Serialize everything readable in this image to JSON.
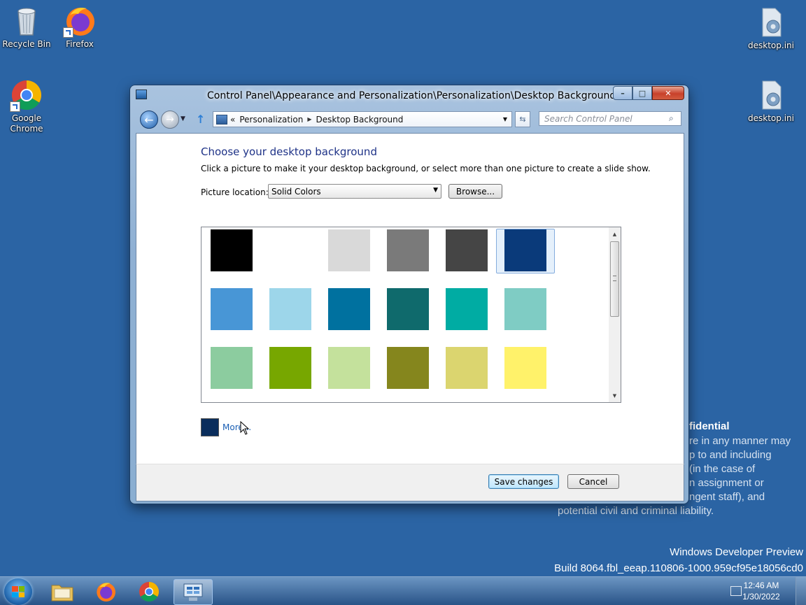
{
  "desktop": {
    "icons": [
      {
        "label": "Recycle Bin",
        "icon": "recycle-bin-icon"
      },
      {
        "label": "Firefox",
        "icon": "firefox-icon"
      },
      {
        "label": "Google Chrome",
        "icon": "chrome-icon"
      },
      {
        "label": "desktop.ini",
        "icon": "settings-file-icon"
      },
      {
        "label": "desktop.ini",
        "icon": "settings-file-icon"
      }
    ],
    "watermark": {
      "confidential_heading": "fidential",
      "lines": [
        "re in any manner may",
        "p to and including",
        "(in the case of",
        "n assignment or",
        "ngent staff), and",
        "potential civil and criminal liability."
      ],
      "product": "Windows Developer Preview",
      "build": "Build 8064.fbl_eeap.110806-1000.959cf95e18056cd0"
    }
  },
  "window": {
    "title": "Control Panel\\Appearance and Personalization\\Personalization\\Desktop Background",
    "buttons": {
      "minimize": "–",
      "maximize": "□",
      "close": "✕"
    },
    "nav": {
      "back": "←",
      "forward": "→",
      "up": "↑",
      "breadcrumb": {
        "prefix": "«",
        "items": [
          "Personalization",
          "Desktop Background"
        ],
        "sep": "▶"
      },
      "search_placeholder": "Search Control Panel"
    },
    "content": {
      "heading": "Choose your desktop background",
      "description": "Click a picture to make it your desktop background, or select more than one picture to create a slide show.",
      "picture_location_label": "Picture location:",
      "picture_location_value": "Solid Colors",
      "browse_label": "Browse...",
      "colors": [
        "#000000",
        "#ffffff",
        "#d9d9d9",
        "#7a7a7a",
        "#454545",
        "#0a3a7a",
        "#4896d6",
        "#9dd6ea",
        "#00719f",
        "#0f6a6c",
        "#00aca3",
        "#7fccc4",
        "#8ccc9f",
        "#77a700",
        "#c4e19c",
        "#85861d",
        "#dbd56f",
        "#fff26a"
      ],
      "selected_color_index": 5,
      "more_color": "#0a2d5c",
      "more_label": "More..."
    },
    "footer": {
      "save_label": "Save changes",
      "cancel_label": "Cancel"
    }
  },
  "taskbar": {
    "items": [
      "file-explorer-icon",
      "firefox-icon",
      "chrome-icon",
      "control-panel-icon"
    ],
    "time": "12:46 AM",
    "date": "1/30/2022"
  }
}
